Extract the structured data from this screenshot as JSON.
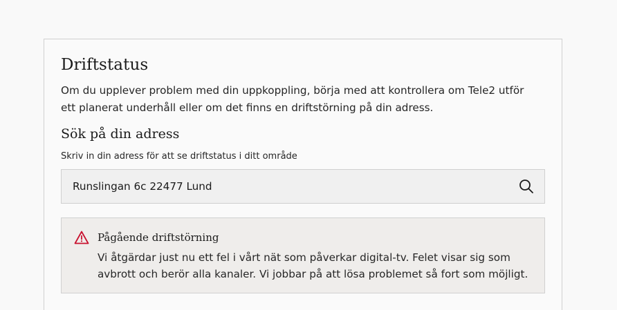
{
  "status_section": {
    "title": "Driftstatus",
    "intro": "Om du upplever problem med din uppkoppling, börja med att kontrollera om Tele2 utför ett planerat underhåll eller om det finns en driftstörning på din adress."
  },
  "search": {
    "heading": "Sök på din adress",
    "hint": "Skriv in din adress för att se driftstatus i ditt område",
    "value": "Runslingan 6c 22477 Lund",
    "icon": "search-icon"
  },
  "alert": {
    "icon": "warning-icon",
    "icon_color": "#c8102e",
    "title": "Pågående driftstörning",
    "body": "Vi åtgärdar just nu ett fel i vårt nät som påverkar digital-tv. Felet visar sig som avbrott och berör alla kanaler. Vi jobbar på att lösa problemet så fort som möjligt."
  }
}
